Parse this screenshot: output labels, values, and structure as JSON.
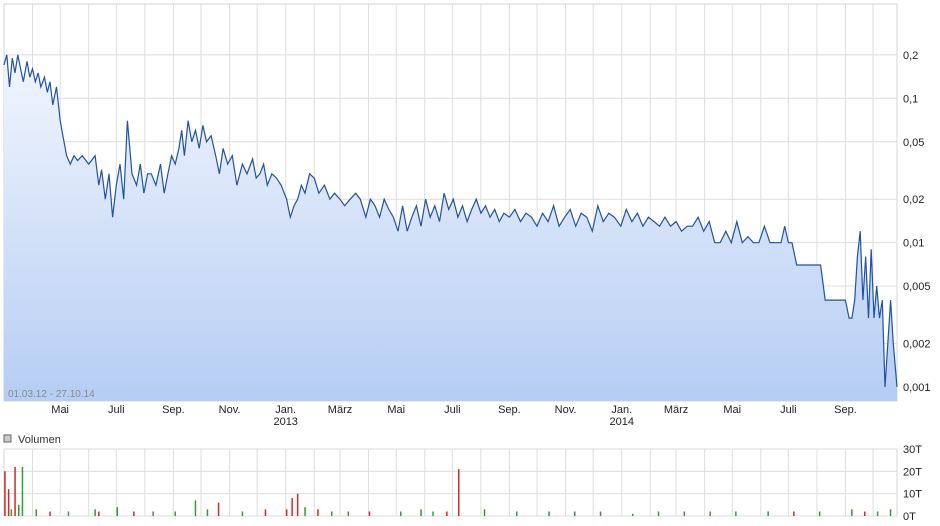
{
  "chart_data": [
    {
      "type": "area",
      "title": "",
      "xlabel": "",
      "ylabel": "",
      "date_range_label": "01.03.12 - 27.10.14",
      "y_scale": "log",
      "ylim": [
        0.0008,
        0.45
      ],
      "xlim": [
        "2012-03-01",
        "2014-10-27"
      ],
      "grid": true,
      "line_color": "#2152a3",
      "fill_top_color": "#f2f6fd",
      "fill_bottom_color": "#b5cdf4",
      "y_ticks": [
        {
          "value": 0.2,
          "label": "0,2"
        },
        {
          "value": 0.1,
          "label": "0,1"
        },
        {
          "value": 0.05,
          "label": "0,05"
        },
        {
          "value": 0.02,
          "label": "0,02"
        },
        {
          "value": 0.01,
          "label": "0,01"
        },
        {
          "value": 0.005,
          "label": "0,005"
        },
        {
          "value": 0.002,
          "label": "0,002"
        },
        {
          "value": 0.001,
          "label": "0,001"
        }
      ],
      "x_ticks": [
        {
          "date": "2012-05-01",
          "label": "Mai",
          "year": ""
        },
        {
          "date": "2012-07-01",
          "label": "Juli",
          "year": ""
        },
        {
          "date": "2012-09-01",
          "label": "Sep.",
          "year": ""
        },
        {
          "date": "2012-11-01",
          "label": "Nov.",
          "year": ""
        },
        {
          "date": "2013-01-01",
          "label": "Jan.",
          "year": "2013"
        },
        {
          "date": "2013-03-01",
          "label": "März",
          "year": ""
        },
        {
          "date": "2013-05-01",
          "label": "Mai",
          "year": ""
        },
        {
          "date": "2013-07-01",
          "label": "Juli",
          "year": ""
        },
        {
          "date": "2013-09-01",
          "label": "Sep.",
          "year": ""
        },
        {
          "date": "2013-11-01",
          "label": "Nov.",
          "year": ""
        },
        {
          "date": "2014-01-01",
          "label": "Jan.",
          "year": "2014"
        },
        {
          "date": "2014-03-01",
          "label": "März",
          "year": ""
        },
        {
          "date": "2014-05-01",
          "label": "Mai",
          "year": ""
        },
        {
          "date": "2014-07-01",
          "label": "Juli",
          "year": ""
        },
        {
          "date": "2014-09-01",
          "label": "Sep.",
          "year": ""
        }
      ],
      "series": [
        {
          "x": [
            "2012-03-01",
            "2012-03-04",
            "2012-03-07",
            "2012-03-10",
            "2012-03-13",
            "2012-03-16",
            "2012-03-19",
            "2012-03-22",
            "2012-03-26",
            "2012-03-29",
            "2012-04-01",
            "2012-04-04",
            "2012-04-07",
            "2012-04-10",
            "2012-04-14",
            "2012-04-17",
            "2012-04-20",
            "2012-04-23",
            "2012-04-27",
            "2012-05-01",
            "2012-05-04",
            "2012-05-08",
            "2012-05-12",
            "2012-05-16",
            "2012-05-20",
            "2012-05-25",
            "2012-06-01",
            "2012-06-08",
            "2012-06-12",
            "2012-06-15",
            "2012-06-19",
            "2012-06-23",
            "2012-06-27",
            "2012-07-01",
            "2012-07-05",
            "2012-07-09",
            "2012-07-13",
            "2012-07-18",
            "2012-07-23",
            "2012-07-27",
            "2012-07-31",
            "2012-08-04",
            "2012-08-08",
            "2012-08-13",
            "2012-08-18",
            "2012-08-22",
            "2012-08-26",
            "2012-08-30",
            "2012-09-03",
            "2012-09-07",
            "2012-09-10",
            "2012-09-13",
            "2012-09-17",
            "2012-09-21",
            "2012-09-25",
            "2012-09-29",
            "2012-10-03",
            "2012-10-07",
            "2012-10-12",
            "2012-10-17",
            "2012-10-21",
            "2012-10-25",
            "2012-10-30",
            "2012-11-04",
            "2012-11-09",
            "2012-11-15",
            "2012-11-20",
            "2012-11-26",
            "2012-11-30",
            "2012-12-04",
            "2012-12-08",
            "2012-12-12",
            "2012-12-17",
            "2012-12-22",
            "2012-12-27",
            "2013-01-02",
            "2013-01-06",
            "2013-01-10",
            "2013-01-14",
            "2013-01-18",
            "2013-01-22",
            "2013-01-27",
            "2013-02-01",
            "2013-02-06",
            "2013-02-12",
            "2013-02-18",
            "2013-02-23",
            "2013-03-01",
            "2013-03-06",
            "2013-03-12",
            "2013-03-18",
            "2013-03-23",
            "2013-03-29",
            "2013-04-03",
            "2013-04-08",
            "2013-04-13",
            "2013-04-18",
            "2013-04-23",
            "2013-04-28",
            "2013-05-03",
            "2013-05-08",
            "2013-05-13",
            "2013-05-18",
            "2013-05-23",
            "2013-05-28",
            "2013-06-02",
            "2013-06-07",
            "2013-06-12",
            "2013-06-17",
            "2013-06-22",
            "2013-06-27",
            "2013-07-02",
            "2013-07-07",
            "2013-07-12",
            "2013-07-17",
            "2013-07-22",
            "2013-07-27",
            "2013-08-01",
            "2013-08-06",
            "2013-08-11",
            "2013-08-16",
            "2013-08-21",
            "2013-08-26",
            "2013-09-01",
            "2013-09-07",
            "2013-09-13",
            "2013-09-19",
            "2013-09-25",
            "2013-10-01",
            "2013-10-07",
            "2013-10-13",
            "2013-10-19",
            "2013-10-25",
            "2013-10-31",
            "2013-11-06",
            "2013-11-12",
            "2013-11-18",
            "2013-11-24",
            "2013-11-30",
            "2013-12-06",
            "2013-12-12",
            "2013-12-18",
            "2013-12-24",
            "2013-12-31",
            "2014-01-06",
            "2014-01-12",
            "2014-01-18",
            "2014-01-24",
            "2014-01-30",
            "2014-02-05",
            "2014-02-11",
            "2014-02-17",
            "2014-02-23",
            "2014-03-01",
            "2014-03-07",
            "2014-03-13",
            "2014-03-19",
            "2014-03-25",
            "2014-03-31",
            "2014-04-06",
            "2014-04-12",
            "2014-04-18",
            "2014-04-24",
            "2014-04-30",
            "2014-05-06",
            "2014-05-12",
            "2014-05-18",
            "2014-05-24",
            "2014-05-30",
            "2014-06-05",
            "2014-06-11",
            "2014-06-17",
            "2014-06-23",
            "2014-06-27",
            "2014-07-01",
            "2014-07-05",
            "2014-07-10",
            "2014-07-20",
            "2014-07-31",
            "2014-08-05",
            "2014-08-10",
            "2014-08-15",
            "2014-08-19",
            "2014-08-24",
            "2014-08-28",
            "2014-09-01",
            "2014-09-05",
            "2014-09-08",
            "2014-09-11",
            "2014-09-14",
            "2014-09-17",
            "2014-09-20",
            "2014-09-23",
            "2014-09-26",
            "2014-09-29",
            "2014-10-02",
            "2014-10-05",
            "2014-10-08",
            "2014-10-11",
            "2014-10-14",
            "2014-10-17",
            "2014-10-20",
            "2014-10-23",
            "2014-10-27"
          ],
          "values": [
            0.17,
            0.2,
            0.12,
            0.19,
            0.15,
            0.2,
            0.16,
            0.13,
            0.18,
            0.14,
            0.16,
            0.13,
            0.15,
            0.12,
            0.14,
            0.11,
            0.13,
            0.09,
            0.12,
            0.07,
            0.055,
            0.04,
            0.035,
            0.04,
            0.037,
            0.04,
            0.035,
            0.04,
            0.025,
            0.032,
            0.02,
            0.03,
            0.015,
            0.025,
            0.035,
            0.02,
            0.07,
            0.03,
            0.025,
            0.035,
            0.022,
            0.03,
            0.03,
            0.025,
            0.035,
            0.022,
            0.03,
            0.04,
            0.035,
            0.045,
            0.06,
            0.04,
            0.07,
            0.05,
            0.06,
            0.045,
            0.065,
            0.05,
            0.055,
            0.04,
            0.03,
            0.045,
            0.035,
            0.04,
            0.025,
            0.035,
            0.03,
            0.038,
            0.028,
            0.03,
            0.035,
            0.025,
            0.03,
            0.028,
            0.025,
            0.02,
            0.015,
            0.018,
            0.02,
            0.025,
            0.022,
            0.03,
            0.028,
            0.022,
            0.025,
            0.02,
            0.022,
            0.02,
            0.018,
            0.02,
            0.022,
            0.02,
            0.015,
            0.02,
            0.018,
            0.015,
            0.02,
            0.017,
            0.015,
            0.012,
            0.018,
            0.012,
            0.015,
            0.018,
            0.013,
            0.02,
            0.015,
            0.018,
            0.014,
            0.022,
            0.017,
            0.02,
            0.015,
            0.018,
            0.014,
            0.017,
            0.02,
            0.016,
            0.018,
            0.015,
            0.017,
            0.014,
            0.016,
            0.015,
            0.017,
            0.014,
            0.016,
            0.015,
            0.013,
            0.016,
            0.014,
            0.018,
            0.013,
            0.015,
            0.017,
            0.013,
            0.016,
            0.015,
            0.012,
            0.018,
            0.014,
            0.016,
            0.015,
            0.013,
            0.017,
            0.014,
            0.016,
            0.013,
            0.015,
            0.014,
            0.013,
            0.015,
            0.013,
            0.014,
            0.012,
            0.013,
            0.013,
            0.015,
            0.012,
            0.014,
            0.01,
            0.01,
            0.012,
            0.01,
            0.014,
            0.01,
            0.011,
            0.01,
            0.01,
            0.013,
            0.01,
            0.01,
            0.01,
            0.013,
            0.01,
            0.01,
            0.007,
            0.007,
            0.007,
            0.007,
            0.004,
            0.004,
            0.004,
            0.004,
            0.004,
            0.004,
            0.003,
            0.003,
            0.004,
            0.008,
            0.012,
            0.004,
            0.008,
            0.003,
            0.009,
            0.003,
            0.005,
            0.003,
            0.004,
            0.001,
            0.002,
            0.004,
            0.002,
            0.001
          ]
        }
      ]
    },
    {
      "type": "bar",
      "legend": "Volumen",
      "y_unit": "T",
      "ylim": [
        0,
        30
      ],
      "grid": true,
      "up_color": "#2ea02e",
      "down_color": "#d02a2a",
      "y_ticks": [
        {
          "value": 30,
          "label": "30T"
        },
        {
          "value": 20,
          "label": "20T"
        },
        {
          "value": 10,
          "label": "10T"
        },
        {
          "value": 0,
          "label": "0T"
        }
      ],
      "x": [
        "2012-03-02",
        "2012-03-06",
        "2012-03-09",
        "2012-03-13",
        "2012-03-17",
        "2012-03-21",
        "2012-04-05",
        "2012-04-20",
        "2012-05-10",
        "2012-06-08",
        "2012-06-12",
        "2012-07-02",
        "2012-07-20",
        "2012-08-10",
        "2012-09-03",
        "2012-09-25",
        "2012-10-08",
        "2012-10-20",
        "2012-11-15",
        "2012-12-10",
        "2013-01-02",
        "2013-01-08",
        "2013-01-14",
        "2013-01-22",
        "2013-02-05",
        "2013-02-20",
        "2013-03-10",
        "2013-04-02",
        "2013-05-06",
        "2013-05-28",
        "2013-06-10",
        "2013-06-25",
        "2013-07-08",
        "2013-08-05",
        "2013-09-09",
        "2013-10-14",
        "2013-11-11",
        "2013-12-09",
        "2014-01-13",
        "2014-02-10",
        "2014-03-10",
        "2014-04-07",
        "2014-05-05",
        "2014-06-09",
        "2014-07-07",
        "2014-08-04",
        "2014-09-08",
        "2014-09-22",
        "2014-10-06",
        "2014-10-20"
      ],
      "values": [
        20,
        12,
        3,
        22,
        5,
        22,
        3,
        2,
        2,
        3,
        2,
        4,
        2,
        2,
        2,
        7,
        3,
        6,
        2,
        3,
        3,
        8,
        10,
        4,
        3,
        2,
        2,
        2,
        2,
        3,
        2,
        2,
        21,
        3,
        2,
        2,
        2,
        2,
        1,
        2,
        2,
        2,
        2,
        2,
        2,
        2,
        3,
        2,
        2,
        3
      ],
      "directions": [
        "down",
        "down",
        "up",
        "down",
        "up",
        "up",
        "up",
        "down",
        "up",
        "up",
        "down",
        "up",
        "down",
        "up",
        "up",
        "up",
        "up",
        "down",
        "up",
        "down",
        "down",
        "down",
        "down",
        "up",
        "down",
        "up",
        "up",
        "down",
        "up",
        "up",
        "up",
        "down",
        "down",
        "up",
        "up",
        "up",
        "up",
        "up",
        "up",
        "up",
        "up",
        "up",
        "up",
        "up",
        "down",
        "up",
        "up",
        "down",
        "up",
        "up"
      ]
    }
  ]
}
